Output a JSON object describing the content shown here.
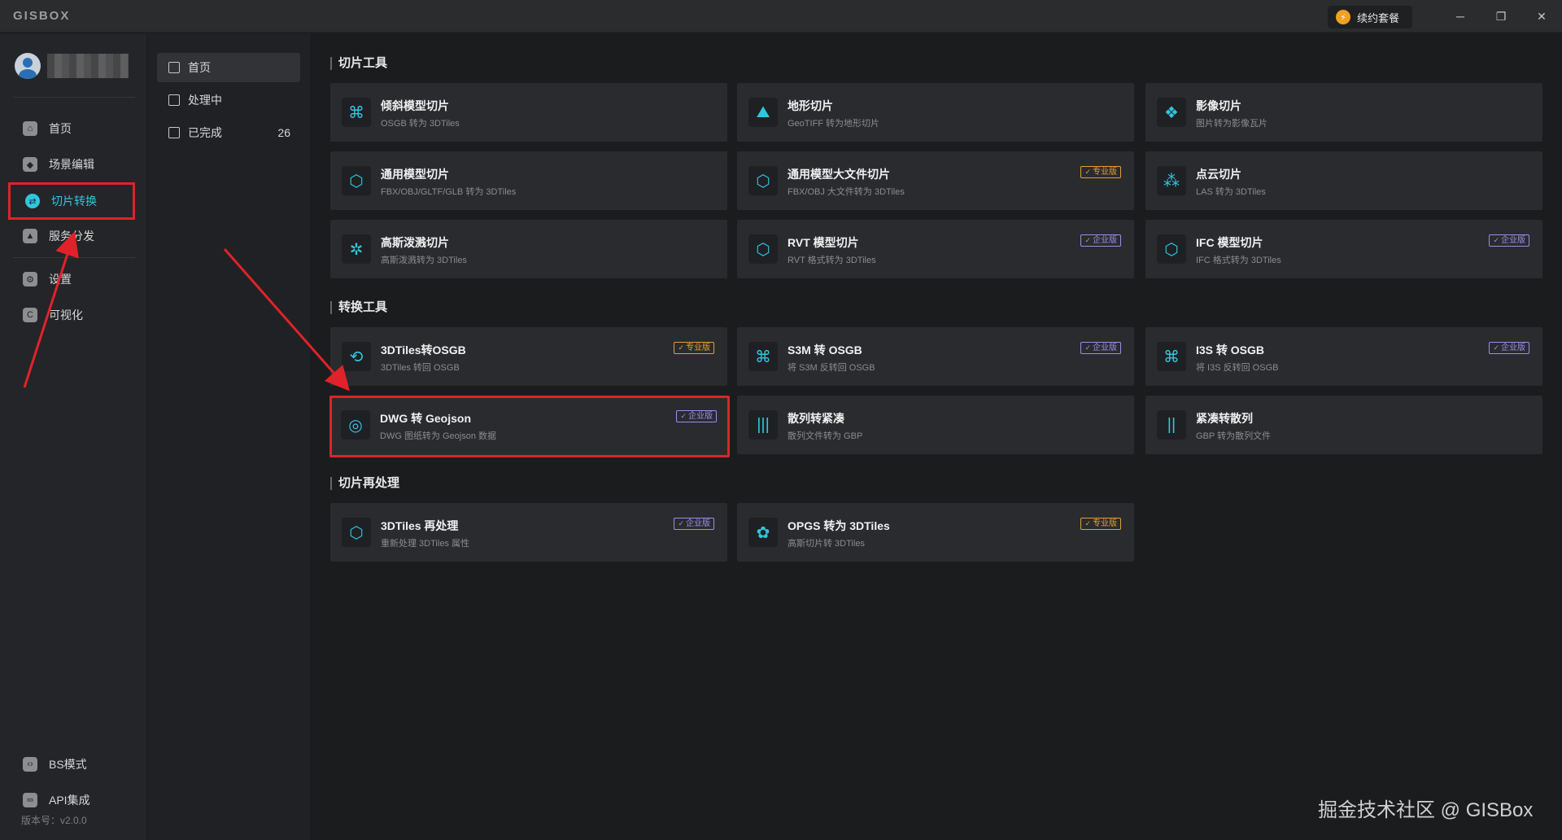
{
  "app": {
    "logo": "GISBOX",
    "renew_label": "续约套餐",
    "bolt_icon": "lightning-icon"
  },
  "window": {
    "minimize": "─",
    "restore": "❐",
    "close": "✕"
  },
  "sidebar": {
    "items": [
      {
        "label": "首页",
        "icon": "home-icon",
        "glyph": "⌂"
      },
      {
        "label": "场景编辑",
        "icon": "cube-icon",
        "glyph": "◆"
      },
      {
        "label": "切片转换",
        "icon": "transform-icon",
        "glyph": "⇄",
        "active": true
      },
      {
        "label": "服务分发",
        "icon": "upload-icon",
        "glyph": "▲"
      },
      {
        "label": "设置",
        "icon": "gear-icon",
        "glyph": "⚙"
      },
      {
        "label": "可视化",
        "icon": "visual-icon",
        "glyph": "C"
      },
      {
        "label": "BS模式",
        "icon": "code-icon",
        "glyph": "‹›"
      },
      {
        "label": "API集成",
        "icon": "link-icon",
        "glyph": "∞"
      }
    ],
    "version": "版本号：v2.0.0"
  },
  "subnav": {
    "items": [
      {
        "label": "首页",
        "count": ""
      },
      {
        "label": "处理中",
        "count": ""
      },
      {
        "label": "已完成",
        "count": "26"
      }
    ]
  },
  "sections": {
    "slice_tools": "切片工具",
    "convert_tools": "转换工具",
    "reprocess": "切片再处理"
  },
  "badges": {
    "pro": "专业版",
    "enterprise": "企业版"
  },
  "cards": {
    "c1": {
      "title": "倾斜模型切片",
      "desc": "OSGB 转为 3DTiles",
      "icon": "oblique-model-icon",
      "glyph": "⌘"
    },
    "c2": {
      "title": "地形切片",
      "desc": "GeoTIFF 转为地形切片",
      "icon": "terrain-icon",
      "glyph": "⛰"
    },
    "c3": {
      "title": "影像切片",
      "desc": "图片转为影像瓦片",
      "icon": "imagery-icon",
      "glyph": "❖"
    },
    "c4": {
      "title": "通用模型切片",
      "desc": "FBX/OBJ/GLTF/GLB 转为 3DTiles",
      "icon": "box-icon",
      "glyph": "⬡"
    },
    "c5": {
      "title": "通用模型大文件切片",
      "desc": "FBX/OBJ 大文件转为 3DTiles",
      "icon": "box-icon",
      "glyph": "⬡"
    },
    "c6": {
      "title": "点云切片",
      "desc": "LAS 转为 3DTiles",
      "icon": "point-cloud-icon",
      "glyph": "⁂"
    },
    "c7": {
      "title": "高斯泼溅切片",
      "desc": "高斯泼溅转为 3DTiles",
      "icon": "gaussian-icon",
      "glyph": "✲"
    },
    "c8": {
      "title": "RVT 模型切片",
      "desc": "RVT 格式转为 3DTiles",
      "icon": "rvt-icon",
      "glyph": "⬡"
    },
    "c9": {
      "title": "IFC 模型切片",
      "desc": "IFC 格式转为 3DTiles",
      "icon": "ifc-icon",
      "glyph": "⬡"
    },
    "c10": {
      "title": "3DTiles转OSGB",
      "desc": "3DTiles 转回 OSGB",
      "icon": "convert-icon",
      "glyph": "⟲"
    },
    "c11": {
      "title": "S3M 转 OSGB",
      "desc": "将 S3M 反转回 OSGB",
      "icon": "s3m-icon",
      "glyph": "⌘"
    },
    "c12": {
      "title": "I3S 转 OSGB",
      "desc": "将 I3S 反转回 OSGB",
      "icon": "i3s-icon",
      "glyph": "⌘"
    },
    "c13": {
      "title": "DWG 转 Geojson",
      "desc": "DWG 图纸转为 Geojson 数据",
      "icon": "target-icon",
      "glyph": "◎"
    },
    "c14": {
      "title": "散列转紧凑",
      "desc": "散列文件转为 GBP",
      "icon": "bars-icon",
      "glyph": "|||"
    },
    "c15": {
      "title": "紧凑转散列",
      "desc": "GBP 转为散列文件",
      "icon": "bars-icon",
      "glyph": "||"
    },
    "c16": {
      "title": "3DTiles 再处理",
      "desc": "重新处理 3DTiles 属性",
      "icon": "reprocess-icon",
      "glyph": "⬡"
    },
    "c17": {
      "title": "OPGS 转为 3DTiles",
      "desc": "高斯切片转 3DTiles",
      "icon": "opgs-icon",
      "glyph": "✿"
    }
  },
  "watermark": "掘金技术社区 @ GISBox",
  "colors": {
    "accent": "#2fc6e0",
    "highlight": "#e0222a",
    "pro": "#e0a030",
    "enterprise": "#9a8ee8"
  }
}
